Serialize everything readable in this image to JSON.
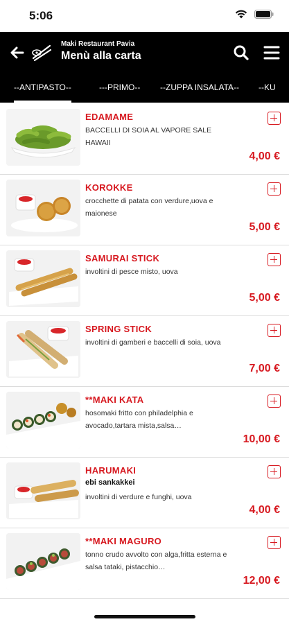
{
  "status_bar": {
    "time": "5:06"
  },
  "header": {
    "subtitle": "Maki Restaurant Pavia",
    "title": "Menù alla carta"
  },
  "tabs": [
    "--ANTIPASTO--",
    "---PRIMO--",
    "--ZUPPA INSALATA--",
    "--KU"
  ],
  "items": [
    {
      "name": "EDAMAME",
      "sub": "",
      "desc": "BACCELLI DI SOIA AL VAPORE SALE HAWAII",
      "price": "4,00 €"
    },
    {
      "name": "KOROKKE",
      "sub": "",
      "desc": "crocchette di patata con verdure,uova e maionese",
      "price": "5,00 €"
    },
    {
      "name": "SAMURAI STICK",
      "sub": "",
      "desc": "involtini di pesce misto, uova",
      "price": "5,00 €"
    },
    {
      "name": "SPRING STICK",
      "sub": "",
      "desc": "involtini di gamberi e baccelli di soia, uova",
      "price": "7,00 €"
    },
    {
      "name": "**MAKI KATA",
      "sub": "",
      "desc": "hosomaki fritto con philadelphia e avocado,tartara mista,salsa…",
      "price": "10,00 €"
    },
    {
      "name": "HARUMAKI",
      "sub": "ebi sankakkei",
      "desc": "involtini di verdure e funghi, uova",
      "price": "4,00 €"
    },
    {
      "name": "**MAKI MAGURO",
      "sub": "",
      "desc": "tonno crudo avvolto con alga,fritta esterna e salsa tataki, pistacchio…",
      "price": "12,00 €"
    }
  ],
  "colors": {
    "accent": "#d71920",
    "header_bg": "#000000"
  }
}
